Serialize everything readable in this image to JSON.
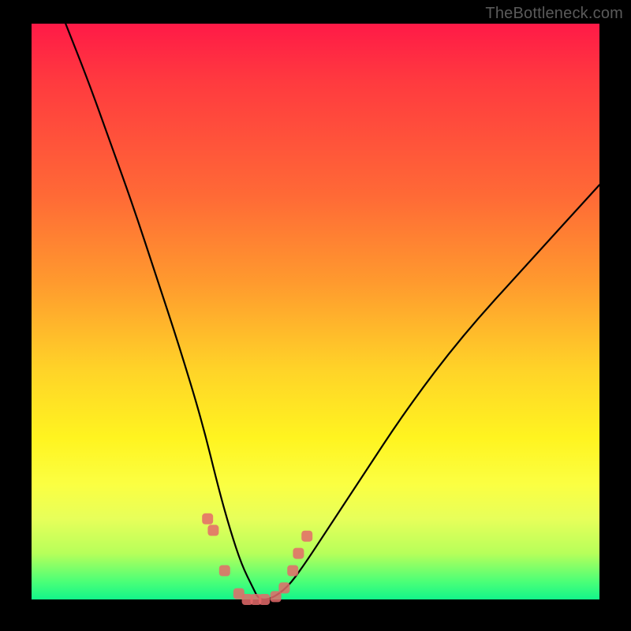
{
  "watermark": "TheBottleneck.com",
  "chart_data": {
    "type": "line",
    "title": "",
    "xlabel": "",
    "ylabel": "",
    "xlim": [
      0,
      100
    ],
    "ylim": [
      0,
      100
    ],
    "grid": false,
    "legend": false,
    "annotations": [],
    "background_gradient": {
      "direction": "vertical",
      "stops": [
        {
          "pos": 0,
          "color": "#ff1a47"
        },
        {
          "pos": 30,
          "color": "#ff6a36"
        },
        {
          "pos": 60,
          "color": "#ffd328"
        },
        {
          "pos": 80,
          "color": "#fbff42"
        },
        {
          "pos": 97,
          "color": "#49ff78"
        },
        {
          "pos": 100,
          "color": "#13f58a"
        }
      ]
    },
    "series": [
      {
        "name": "bottleneck-curve",
        "color": "#000000",
        "x": [
          6,
          10,
          14,
          18,
          22,
          26,
          30,
          33,
          35,
          37,
          39,
          40,
          42,
          45,
          48,
          52,
          58,
          66,
          76,
          88,
          100
        ],
        "y": [
          100,
          90,
          79,
          68,
          56,
          44,
          31,
          19,
          12,
          6,
          2,
          0,
          0,
          2,
          6,
          12,
          21,
          33,
          46,
          59,
          72
        ]
      },
      {
        "name": "highlight-dots",
        "color": "#e46a6a",
        "type": "scatter",
        "x": [
          31,
          32,
          34,
          36.5,
          38,
          39.5,
          41,
          43,
          44.5,
          46,
          47,
          48.5
        ],
        "y": [
          14,
          12,
          5,
          1,
          0,
          0,
          0,
          0.5,
          2,
          5,
          8,
          11
        ]
      }
    ],
    "bottom_band": {
      "color": "#13f58a",
      "y_range": [
        0,
        3
      ]
    }
  }
}
